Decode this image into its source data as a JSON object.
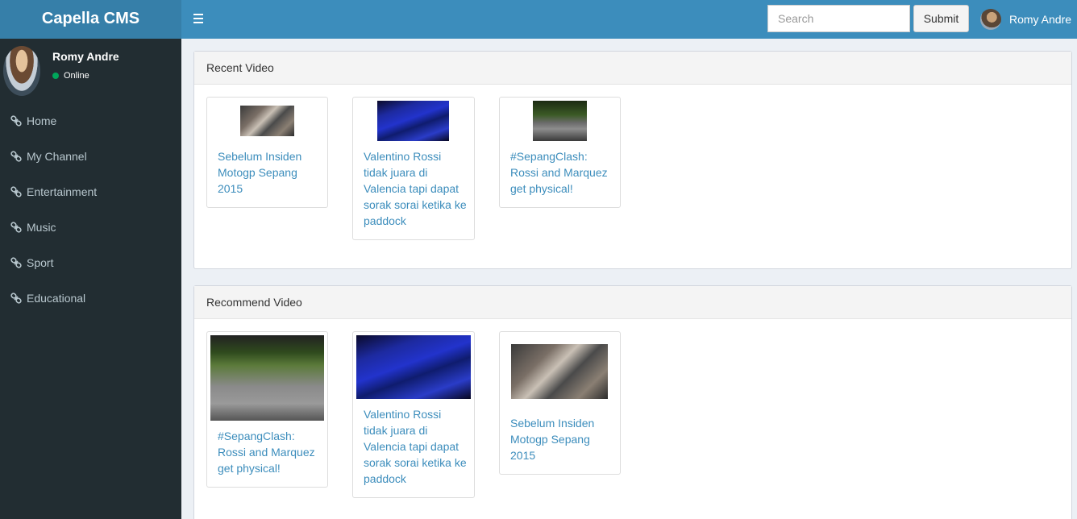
{
  "app": {
    "title": "Capella CMS"
  },
  "header": {
    "search_placeholder": "Search",
    "submit_label": "Submit",
    "user_name": "Romy Andre"
  },
  "sidebar": {
    "user_name": "Romy Andre",
    "status": "Online",
    "items": [
      {
        "label": "Home",
        "icon": "link-icon"
      },
      {
        "label": "My Channel",
        "icon": "link-icon"
      },
      {
        "label": "Entertainment",
        "icon": "link-icon"
      },
      {
        "label": "Music",
        "icon": "link-icon"
      },
      {
        "label": "Sport",
        "icon": "link-icon"
      },
      {
        "label": "Educational",
        "icon": "link-icon"
      }
    ]
  },
  "recent": {
    "title": "Recent Video",
    "videos": [
      {
        "title": "Sebelum Insiden Motogp Sepang 2015"
      },
      {
        "title": "Valentino Rossi tidak juara di Valencia tapi dapat sorak sorai ketika ke paddock"
      },
      {
        "title": "#SepangClash: Rossi and Marquez get physical!"
      }
    ]
  },
  "recommend": {
    "title": "Recommend Video",
    "videos": [
      {
        "title": "#SepangClash: Rossi and Marquez get physical!"
      },
      {
        "title": "Valentino Rossi tidak juara di Valencia tapi dapat sorak sorai ketika ke paddock"
      },
      {
        "title": "Sebelum Insiden Motogp Sepang 2015"
      }
    ]
  },
  "colors": {
    "header": "#3c8dbc",
    "logo": "#367fa9",
    "sidebar": "#222d32",
    "link": "#3c8dbc",
    "online": "#00a65a"
  }
}
